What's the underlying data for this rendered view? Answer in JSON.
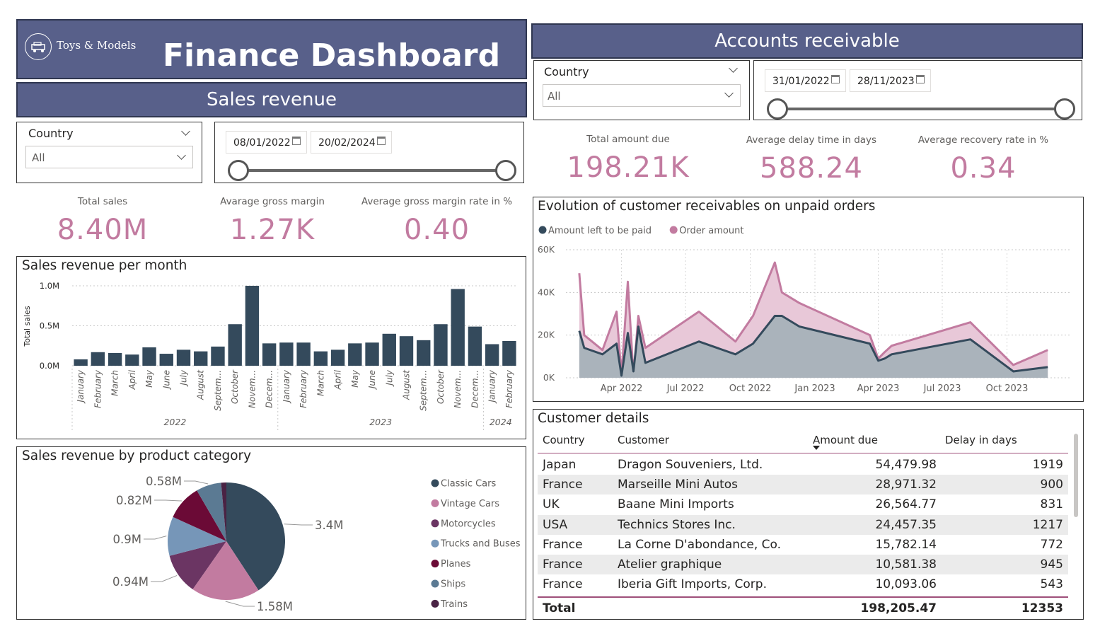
{
  "header": {
    "brand": "Toys & Models",
    "title": "Finance Dashboard",
    "sales_section": "Sales revenue",
    "ar_section": "Accounts receivable"
  },
  "sales_filters": {
    "country_label": "Country",
    "country_value": "All",
    "date_start": "08/01/2022",
    "date_end": "20/02/2024"
  },
  "ar_filters": {
    "country_label": "Country",
    "country_value": "All",
    "date_start": "31/01/2022",
    "date_end": "28/11/2023"
  },
  "sales_kpis": [
    {
      "label": "Total sales",
      "value": "8.40M"
    },
    {
      "label": "Avarage gross margin",
      "value": "1.27K"
    },
    {
      "label": "Average gross margin rate in %",
      "value": "0.40"
    }
  ],
  "ar_kpis": [
    {
      "label": "Total amount due",
      "value": "198.21K"
    },
    {
      "label": "Average delay time in days",
      "value": "588.24"
    },
    {
      "label": "Average recovery rate in %",
      "value": "0.34"
    }
  ],
  "colors": {
    "banner": "#58608a",
    "accent_pink": "#c27ba0",
    "dark_slate": "#344a5c"
  },
  "chart_data": [
    {
      "type": "bar",
      "title": "Sales revenue per month",
      "ylabel": "Total sales",
      "xlabel": "",
      "ylim": [
        0,
        1000000
      ],
      "yticks": [
        "0.0M",
        "0.5M",
        "1.0M"
      ],
      "categories": [
        "January",
        "February",
        "March",
        "April",
        "May",
        "June",
        "July",
        "August",
        "Septem...",
        "October",
        "Novem...",
        "Decem...",
        "January",
        "February",
        "March",
        "April",
        "May",
        "June",
        "July",
        "August",
        "Septem...",
        "October",
        "Novem...",
        "Decem...",
        "January",
        "February"
      ],
      "years": [
        {
          "label": "2022",
          "start": 0,
          "end": 11
        },
        {
          "label": "2023",
          "start": 12,
          "end": 23
        },
        {
          "label": "2024",
          "start": 24,
          "end": 25
        }
      ],
      "values": [
        80000,
        170000,
        160000,
        140000,
        230000,
        150000,
        200000,
        180000,
        240000,
        520000,
        1000000,
        280000,
        290000,
        290000,
        180000,
        200000,
        280000,
        290000,
        400000,
        370000,
        320000,
        520000,
        960000,
        490000,
        270000,
        310000
      ]
    },
    {
      "type": "pie",
      "title": "Sales revenue by product category",
      "series": [
        {
          "name": "Classic Cars",
          "value": 3.4,
          "label": "3.4M",
          "color": "#344a5c"
        },
        {
          "name": "Vintage Cars",
          "value": 1.58,
          "label": "1.58M",
          "color": "#c27ba0"
        },
        {
          "name": "Motorcycles",
          "value": 0.94,
          "label": "0.94M",
          "color": "#6b3563"
        },
        {
          "name": "Trucks and Buses",
          "value": 0.9,
          "label": "0.9M",
          "color": "#7696b8"
        },
        {
          "name": "Planes",
          "value": 0.82,
          "label": "0.82M",
          "color": "#6b0a36"
        },
        {
          "name": "Ships",
          "value": 0.58,
          "label": "0.58M",
          "color": "#5b7a93"
        },
        {
          "name": "Trains",
          "value": 0.12,
          "label": "",
          "color": "#4a2344"
        }
      ]
    },
    {
      "type": "area",
      "title": "Evolution of customer receivables on unpaid orders",
      "ylim": [
        0,
        60000
      ],
      "yticks": [
        "0K",
        "20K",
        "40K",
        "60K"
      ],
      "xticks": [
        "Apr 2022",
        "Jul 2022",
        "Oct 2022",
        "Jan 2023",
        "Apr 2023",
        "Jul 2023",
        "Oct 2023"
      ],
      "x": [
        "2022-01-31",
        "2022-02-07",
        "2022-03-05",
        "2022-03-25",
        "2022-04-01",
        "2022-04-10",
        "2022-04-18",
        "2022-04-25",
        "2022-05-05",
        "2022-07-20",
        "2022-09-10",
        "2022-10-05",
        "2022-11-05",
        "2022-11-15",
        "2022-12-10",
        "2023-03-20",
        "2023-04-01",
        "2023-04-10",
        "2023-04-20",
        "2023-08-10",
        "2023-10-10",
        "2023-11-28"
      ],
      "series": [
        {
          "name": "Order amount",
          "color": "#c27ba0",
          "values": [
            49000,
            20000,
            13000,
            31000,
            1000,
            45000,
            1000,
            29000,
            14000,
            31000,
            17000,
            29000,
            54000,
            40000,
            35000,
            20000,
            9000,
            12000,
            15000,
            26000,
            6000,
            13000
          ]
        },
        {
          "name": "Amount left to be paid",
          "color": "#344a5c",
          "values": [
            22000,
            14000,
            11000,
            16000,
            1000,
            21000,
            3000,
            24000,
            7000,
            17000,
            11000,
            16000,
            29000,
            29000,
            24000,
            16000,
            8000,
            9000,
            11000,
            18000,
            3000,
            5000
          ]
        }
      ],
      "legend_order": [
        "Amount left to be paid",
        "Order amount"
      ]
    }
  ],
  "table": {
    "title": "Customer details",
    "columns": [
      "Country",
      "Customer",
      "Amount due",
      "Delay in days"
    ],
    "rows": [
      [
        "Japan",
        "Dragon Souveniers, Ltd.",
        "54,479.98",
        "1919"
      ],
      [
        "France",
        "Marseille Mini Autos",
        "28,971.32",
        "900"
      ],
      [
        "UK",
        "Baane Mini Imports",
        "26,564.77",
        "831"
      ],
      [
        "USA",
        "Technics Stores Inc.",
        "24,457.35",
        "1217"
      ],
      [
        "France",
        "La Corne D'abondance, Co.",
        "15,782.14",
        "772"
      ],
      [
        "France",
        "Atelier graphique",
        "10,581.38",
        "945"
      ],
      [
        "France",
        "Iberia Gift Imports, Corp.",
        "10,093.06",
        "543"
      ]
    ],
    "total_label": "Total",
    "total_amount": "198,205.47",
    "total_delay": "12353"
  }
}
